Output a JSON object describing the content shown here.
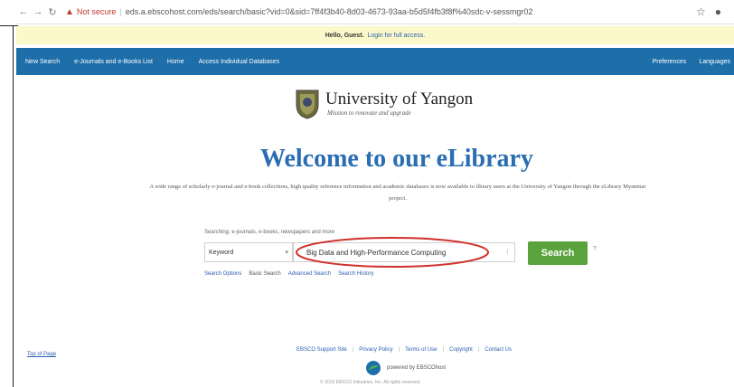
{
  "browser": {
    "not_secure": "Not secure",
    "url": "eds.a.ebscohost.com/eds/search/basic?vid=0&sid=7ff4f3b40-8d03-4673-93aa-b5d5f4fb3f8f%40sdc-v-sessmgr02"
  },
  "guest_bar": {
    "greeting": "Hello, Guest.",
    "login_link": "Login for full access."
  },
  "nav": {
    "items": [
      "New Search",
      "e-Journals and e-Books List",
      "Home",
      "Access Individual Databases"
    ],
    "right_items": [
      "Preferences",
      "Languages"
    ]
  },
  "logo": {
    "name": "University of Yangon",
    "motto": "Mission to renovate and upgrade"
  },
  "welcome": "Welcome to our eLibrary",
  "description": "A wide range of scholarly e-journal and e-book collections, high quality reference information and academic databases is now available to library users at the University of Yangon through the eLibrary Myanmar project.",
  "search": {
    "caption": "Searching: e-journals, e-books, newspapers and more",
    "field_value": "Keyword",
    "query_value": "Big Data and High-Performance Computing",
    "button_label": "Search",
    "help_label": "?",
    "sublinks": [
      "Search Options",
      "Basic Search",
      "Advanced Search",
      "Search History"
    ],
    "highlight_color": "#d0312d",
    "button_color": "#5aa23b"
  },
  "footer": {
    "top_of_page": "Top of Page",
    "links": [
      "EBSCO Support Site",
      "Privacy Policy",
      "Terms of Use",
      "Copyright",
      "Contact Us"
    ],
    "powered": "powered by EBSCOhost",
    "copyright": "© 2019 EBSCO Industries, Inc. All rights reserved."
  }
}
